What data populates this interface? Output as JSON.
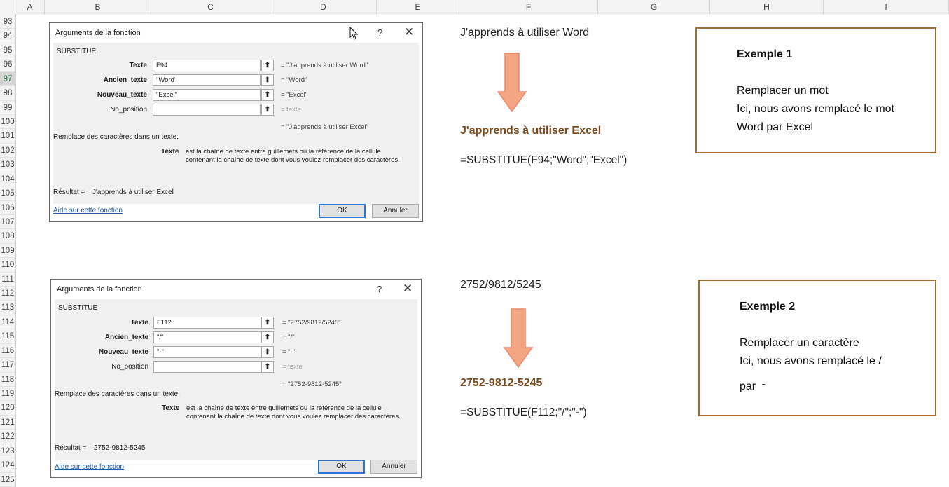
{
  "columns": [
    "A",
    "B",
    "C",
    "D",
    "E",
    "F",
    "G",
    "H",
    "I"
  ],
  "rows": [
    "93",
    "94",
    "95",
    "96",
    "97",
    "98",
    "99",
    "100",
    "101",
    "102",
    "103",
    "104",
    "105",
    "106",
    "107",
    "108",
    "109",
    "110",
    "111",
    "112",
    "113",
    "114",
    "115",
    "116",
    "117",
    "118",
    "119",
    "120",
    "121",
    "122",
    "123",
    "124",
    "125"
  ],
  "selected_row": "97",
  "dialog1": {
    "title": "Arguments de la fonction",
    "help_glyph": "?",
    "close_glyph": "✕",
    "function_name": "SUBSTITUE",
    "args": [
      {
        "label": "Texte",
        "value": "F94",
        "result": "= \"J'apprends à utiliser Word\""
      },
      {
        "label": "Ancien_texte",
        "value": "\"Word\"",
        "result": "= \"Word\""
      },
      {
        "label": "Nouveau_texte",
        "value": "\"Excel\"",
        "result": "= \"Excel\""
      },
      {
        "label": "No_position",
        "value": "",
        "result": "= texte"
      }
    ],
    "collapse_glyph": "⬆",
    "overall_result": "= \"J'apprends à utiliser Excel\"",
    "description": "Remplace des caractères dans un texte.",
    "arg_help_label": "Texte",
    "arg_help_line1": "est la chaîne de texte entre guillemets ou la référence de la cellule",
    "arg_help_line2": "contenant la chaîne de texte dont vous voulez remplacer des caractères.",
    "result_label": "Résultat =",
    "result_value": "J'apprends à utiliser Excel",
    "help_link": "Aide sur cette fonction",
    "ok": "OK",
    "cancel": "Annuler"
  },
  "dialog2": {
    "title": "Arguments de la fonction",
    "help_glyph": "?",
    "close_glyph": "✕",
    "function_name": "SUBSTITUE",
    "args": [
      {
        "label": "Texte",
        "value": "F112",
        "result": "= \"2752/9812/5245\""
      },
      {
        "label": "Ancien_texte",
        "value": "\"/\"",
        "result": "= \"/\""
      },
      {
        "label": "Nouveau_texte",
        "value": "\"-\"",
        "result": "= \"-\""
      },
      {
        "label": "No_position",
        "value": "",
        "result": "= texte"
      }
    ],
    "collapse_glyph": "⬆",
    "overall_result": "= \"2752-9812-5245\"",
    "description": "Remplace des caractères dans un texte.",
    "arg_help_label": "Texte",
    "arg_help_line1": "est la chaîne de texte entre guillemets ou la référence de la cellule",
    "arg_help_line2": "contenant la chaîne de texte dont vous voulez remplacer des caractères.",
    "result_label": "Résultat =",
    "result_value": "2752-9812-5245",
    "help_link": "Aide sur cette fonction",
    "ok": "OK",
    "cancel": "Annuler"
  },
  "example1": {
    "source_text": "J'apprends à utiliser Word",
    "result_text": "J'apprends à utiliser Excel",
    "formula": "=SUBSTITUE(F94;\"Word\";\"Excel\")",
    "box_title": "Exemple 1",
    "box_line1": "Remplacer un mot",
    "box_line2": "Ici, nous avons remplacé le mot",
    "box_line3": "Word par Excel"
  },
  "example2": {
    "source_text": "2752/9812/5245",
    "result_text": "2752-9812-5245",
    "formula": "=SUBSTITUE(F112;\"/\";\"-\")",
    "box_title": "Exemple 2",
    "box_line1": "Remplacer un caractère",
    "box_line2": "Ici, nous avons remplacé le /",
    "box_line3": "par",
    "box_line3_symbol": "-"
  },
  "colors": {
    "arrow": "#f4a582",
    "arrow_stroke": "#e8896a",
    "box_border": "#a86a2e",
    "result_text": "#7a4a1c",
    "link": "#1e5aa8"
  }
}
